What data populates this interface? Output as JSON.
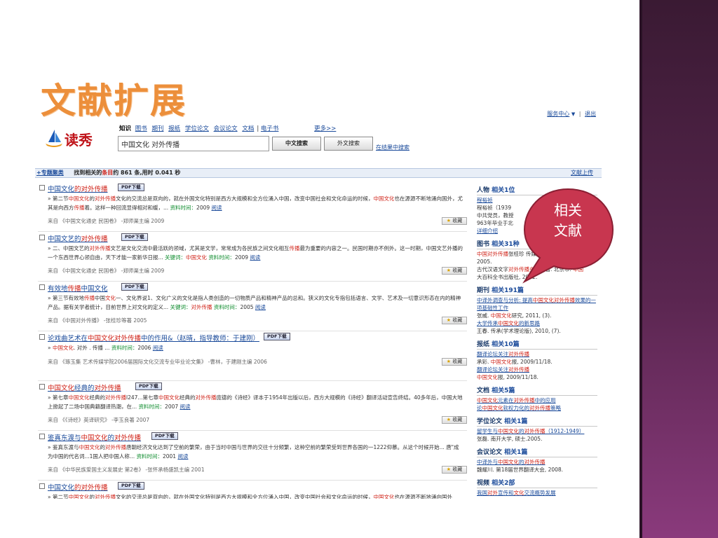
{
  "slide_title": "文献扩展",
  "top_links": {
    "service": "服务中心",
    "logout": "退出"
  },
  "logo_text": "读秀",
  "nav": {
    "active": "知识",
    "items": [
      "图书",
      "期刊",
      "报纸",
      "学位论文",
      "会议论文",
      "文档",
      "电子书"
    ],
    "more": "更多>>"
  },
  "search": {
    "value": "中国文化 对外传播",
    "btn_cn": "中文搜索",
    "btn_foreign": "外文搜索",
    "in_results": "在结果中搜索"
  },
  "bar": {
    "cluster": "+专题聚类",
    "found_a": "找到相关的",
    "found_kw": "条目",
    "found_b": "约 861 条,用时 0.041 秒",
    "upload": "文献上传"
  },
  "pdf_label": "PDF下载",
  "fav_label": "收藏",
  "results": [
    {
      "title": [
        [
          "",
          "中国文化"
        ],
        [
          "hl",
          "的对外传播"
        ]
      ],
      "abs": [
        [
          "",
          "» 第二节"
        ],
        [
          "hl",
          "中国文化"
        ],
        [
          "",
          "的"
        ],
        [
          "hl",
          "对外传播"
        ],
        [
          "",
          "文化的交流总是双向的，就在外国文化特别是西方大规模和全方位涌入中国，改变中国社会和文化命运的时候，"
        ],
        [
          "hl",
          "中国文化"
        ],
        [
          "",
          "也在源源不断地涌向国外，尤其是向西方"
        ],
        [
          "hl",
          "传播"
        ],
        [
          "",
          "着。这样一种回流显得相对和缓，... "
        ],
        [
          "kw",
          "资料时间："
        ],
        [
          "",
          "2009 "
        ],
        [
          "a",
          "阅读"
        ]
      ],
      "src": "来自 《中国文化通史 民国卷》 -郑师渠主编 2009"
    },
    {
      "title": [
        [
          "",
          "中国文艺的"
        ],
        [
          "hl",
          "对外传播"
        ]
      ],
      "abs": [
        [
          "",
          "» 二、中国文艺的"
        ],
        [
          "hl",
          "对外传播"
        ],
        [
          "",
          "文艺是文化交流中最活跃的领域，尤其是文学，常常成为各民族之间文化相互"
        ],
        [
          "hl",
          "传播"
        ],
        [
          "",
          "最为重要的内容之一。民国时期亦不例外。这一时期，中国文艺外播的一个东西世界心领自由，天下才能一家新华日报... "
        ],
        [
          "kw",
          "关键词："
        ],
        [
          "hl",
          "中国文化"
        ],
        [
          "kw",
          " 资料时间："
        ],
        [
          "",
          "2009 "
        ],
        [
          "a",
          "阅读"
        ]
      ],
      "src": "来自 《中国文化通史 民国卷》 -郑师渠主编 2009"
    },
    {
      "title": [
        [
          "",
          "有效地"
        ],
        [
          "hl",
          "传播"
        ],
        [
          "",
          "中国文化"
        ]
      ],
      "abs": [
        [
          "",
          "» 第三节有效地"
        ],
        [
          "hl",
          "传播"
        ],
        [
          "",
          "中国"
        ],
        [
          "hl",
          "文化"
        ],
        [
          "",
          "一、文化界说1、文化广义的文化是指人类创造的一切物质产品和精神产品的总和。狭义的文化专指包括语言、文学、艺术及一切意识形态在内的精神产品。据有关学者统计，目前世界上对文化的定义... "
        ],
        [
          "kw",
          "关键词："
        ],
        [
          "hl",
          "对外传播"
        ],
        [
          "kw",
          " 资料时间："
        ],
        [
          "",
          "2005 "
        ],
        [
          "a",
          "阅读"
        ]
      ],
      "src": "来自 《中国对外传播》 -张桂珍等著 2005"
    },
    {
      "title": [
        [
          "",
          "论戏曲艺术在"
        ],
        [
          "hl",
          "中国文化"
        ],
        [
          "hl",
          "对外传播"
        ],
        [
          "",
          "中的作用&（赵晴，指导教师：于建刚）"
        ]
      ],
      "abs": [
        [
          "",
          "» "
        ],
        [
          "hl",
          "中国文化"
        ],
        [
          "",
          ". 对外 . 传播 ... "
        ],
        [
          "kw",
          "资料时间："
        ],
        [
          "",
          "2006 "
        ],
        [
          "a",
          "阅读"
        ]
      ],
      "src": "来自 《琢玉集 艺术传媒学院2006届国际文化交流专业毕业论文集》 -曹林，于建刚主编 2006"
    },
    {
      "title": [
        [
          "hl",
          "中国文化"
        ],
        [
          "",
          "经典的"
        ],
        [
          "hl",
          "对外传播"
        ]
      ],
      "abs": [
        [
          "",
          "» 第七章"
        ],
        [
          "hl",
          "中国文化"
        ],
        [
          "",
          "经典的"
        ],
        [
          "hl",
          "对外传播"
        ],
        [
          "",
          "l247...第七章"
        ],
        [
          "hl",
          "中国文化"
        ],
        [
          "",
          "经典的"
        ],
        [
          "hl",
          "对外传播"
        ],
        [
          "",
          "庞德的《诗经》译本于1954年出版以后，西方大规模的《诗经》翻译活动宣告终结。40多年后，中国大地上掀起了二场中国典籍翻译热潮，在... "
        ],
        [
          "kw",
          "资料时间："
        ],
        [
          "",
          "2007 "
        ],
        [
          "a",
          "阅读"
        ]
      ],
      "src": "来自 《《诗经》英译研究》 -李玉良著 2007"
    },
    {
      "title": [
        [
          "",
          "鉴真东渡与"
        ],
        [
          "hl",
          "中国文化"
        ],
        [
          "",
          "的"
        ],
        [
          "hl",
          "对外传播"
        ]
      ],
      "abs": [
        [
          "",
          "» 鉴真东渡与"
        ],
        [
          "hl",
          "中国文化"
        ],
        [
          "",
          "的"
        ],
        [
          "hl",
          "对外传播"
        ],
        [
          "",
          "唐朝经济文化达到了空前的繁荣，由于当时中国与世界的交往十分频繁，这种空前的繁荣受到世界各国的一1222仰慕。从这个时候开始... 唐\"成为中国的代名词...1国人把中国人称... "
        ],
        [
          "kw",
          "资料时间："
        ],
        [
          "",
          "2001 "
        ],
        [
          "a",
          "阅读"
        ]
      ],
      "src": "来自 《中华民族爱国主义发展史 第2卷》 -张怀承杨盛凯主编 2001"
    },
    {
      "title": [
        [
          "",
          "中国文化"
        ],
        [
          "hl",
          "的对外传播"
        ]
      ],
      "abs": [
        [
          "",
          "» 第二节"
        ],
        [
          "hl",
          "中国文化"
        ],
        [
          "",
          "的"
        ],
        [
          "hl",
          "对外传播"
        ],
        [
          "",
          "文化的交流总是双向的，就在外国文化特别是西方大规模和全方位涌入中国，改变中国社会和文化命运的时候，"
        ],
        [
          "hl",
          "中国文化"
        ],
        [
          "",
          "也在源源不断地涌向国外"
        ]
      ],
      "src": ""
    }
  ],
  "sidebar": [
    {
      "head": "人物",
      "count": "相关1位",
      "lines": [
        [
          "l",
          [
            [
              "",
              "程裕祯"
            ]
          ]
        ],
        [
          "t",
          [
            [
              "",
              " 程裕祯（1939"
            ]
          ]
        ],
        [
          "t",
          [
            [
              "",
              "中共党员，教授"
            ]
          ]
        ],
        [
          "t",
          [
            [
              "",
              "963年毕业于北"
            ]
          ]
        ],
        [
          "l",
          [
            [
              "",
              "详细介绍"
            ]
          ]
        ]
      ]
    },
    {
      "head": "图书",
      "count": "相关31种",
      "lines": [
        [
          "t",
          [
            [
              "hl",
              "中国对外传播"
            ],
            [
              "",
              "张桂珍"
            ],
            [
              "",
              " 传媒大学出版社,"
            ]
          ]
        ],
        [
          "t",
          [
            [
              "",
              "2005."
            ]
          ]
        ],
        [
          "t",
          [
            [
              "",
              "古代汉语文字"
            ],
            [
              "hl",
              "对外传播史"
            ],
            [
              "",
              "董明著. 北京市: "
            ],
            [
              "hl",
              "中国"
            ]
          ]
        ],
        [
          "t",
          [
            [
              "",
              "大百科全书出版社, 2002."
            ]
          ]
        ]
      ]
    },
    {
      "head": "期刊",
      "count": "相关191篇",
      "lines": [
        [
          "l",
          [
            [
              "",
              "中译外调查与分析: 提高"
            ],
            [
              "hl",
              "中国文化对外传播"
            ],
            [
              "",
              "效果的一项基础性工作"
            ]
          ]
        ],
        [
          "t",
          [
            [
              "",
              "张威. "
            ],
            [
              "hl",
              "中国文化"
            ],
            [
              "",
              "研究, 2011, (3)."
            ]
          ]
        ],
        [
          "l",
          [
            [
              "",
              "大学传承"
            ],
            [
              "hl",
              "中国文化"
            ],
            [
              "",
              "的新思路"
            ]
          ]
        ],
        [
          "t",
          [
            [
              "",
              "王春. 传承(学术理论版), 2010, (7)."
            ]
          ]
        ]
      ]
    },
    {
      "head": "报纸",
      "count": "相关10篇",
      "lines": [
        [
          "l",
          [
            [
              "",
              "翻译论坛关注"
            ],
            [
              "hl",
              "对外传播"
            ]
          ]
        ],
        [
          "t",
          [
            [
              "",
              "承彩. "
            ],
            [
              "hl",
              "中国文化"
            ],
            [
              "",
              "报, 2009/11/18."
            ]
          ]
        ],
        [
          "l",
          [
            [
              "",
              "翻译论坛关注"
            ],
            [
              "hl",
              "对外传播"
            ]
          ]
        ],
        [
          "t",
          [
            [
              "hl",
              "中国文化"
            ],
            [
              "",
              "报, 2009/11/18."
            ]
          ]
        ]
      ]
    },
    {
      "head": "文档",
      "count": "相关5篇",
      "lines": [
        [
          "l",
          [
            [
              "hl",
              "中国文化"
            ],
            [
              "",
              "元素在"
            ],
            [
              "hl",
              "对外传播"
            ],
            [
              "",
              "中的应用"
            ]
          ]
        ],
        [
          "l",
          [
            [
              "",
              "论"
            ],
            [
              "hl",
              "中国文化"
            ],
            [
              "",
              "软权力化的"
            ],
            [
              "hl",
              "对外传播"
            ],
            [
              "",
              "策略"
            ]
          ]
        ]
      ]
    },
    {
      "head": "学位论文",
      "count": "相关1篇",
      "lines": [
        [
          "l",
          [
            [
              "",
              "留学生与"
            ],
            [
              "hl",
              "中国文化"
            ],
            [
              "",
              "的"
            ],
            [
              "hl",
              "对外传播"
            ],
            [
              "",
              "（1912-1949）"
            ]
          ]
        ],
        [
          "t",
          [
            [
              "",
              "张磊. 南开大学, 硕士.2005."
            ]
          ]
        ]
      ]
    },
    {
      "head": "会议论文",
      "count": "相关1篇",
      "lines": [
        [
          "l",
          [
            [
              "",
              "中译外与"
            ],
            [
              "hl",
              "中国文化"
            ],
            [
              "",
              "的"
            ],
            [
              "hl",
              "对外传播"
            ]
          ]
        ],
        [
          "t",
          [
            [
              "",
              "魏耀川. 第18届世界翻译大会, 2008."
            ]
          ]
        ]
      ]
    },
    {
      "head": "视频",
      "count": "相关2部",
      "lines": [
        [
          "l",
          [
            [
              "",
              "我国"
            ],
            [
              "hl",
              "对外"
            ],
            [
              "",
              "宣传和"
            ],
            [
              "hl",
              "文化"
            ],
            [
              "",
              "交流概势发展"
            ]
          ]
        ]
      ]
    }
  ],
  "callout_lines": [
    "相关",
    "文献"
  ],
  "colors": {
    "accent_title": "#ec8f3b",
    "highlight": "#d0241a",
    "link": "#1a4a9a",
    "callout": "#c8364f",
    "band": "#5a2650"
  }
}
